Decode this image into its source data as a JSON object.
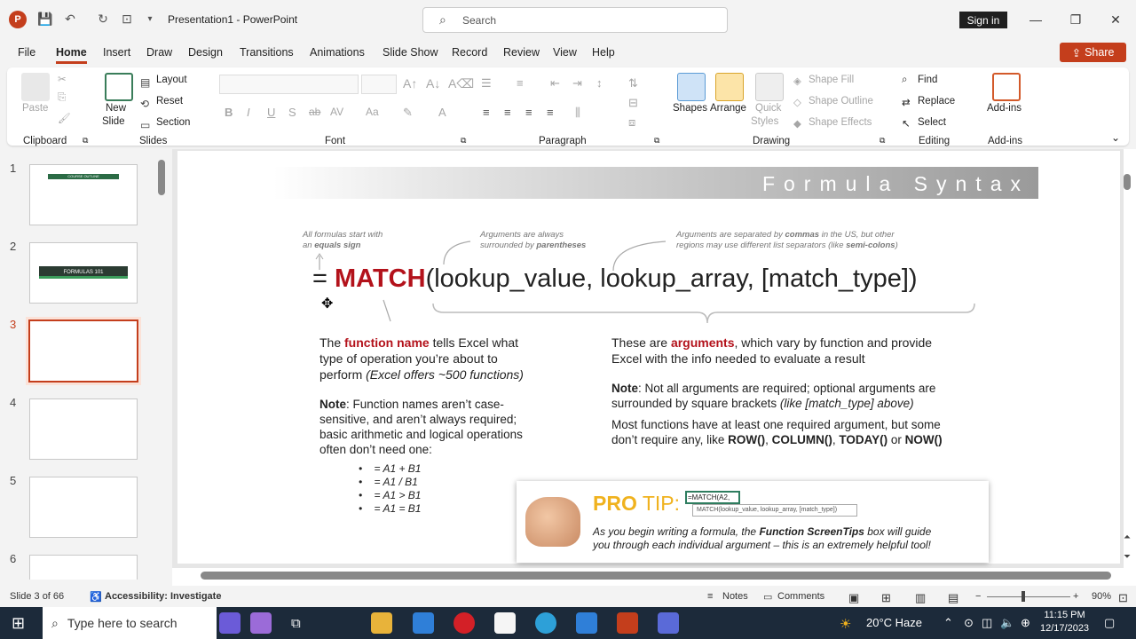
{
  "app": {
    "title": "Presentation1  -  PowerPoint",
    "search_placeholder": "Search",
    "signin": "Sign in",
    "share": "Share"
  },
  "menu": [
    "File",
    "Home",
    "Insert",
    "Draw",
    "Design",
    "Transitions",
    "Animations",
    "Slide Show",
    "Record",
    "Review",
    "View",
    "Help"
  ],
  "ribbon": {
    "clipboard": {
      "label": "Clipboard",
      "paste": "Paste"
    },
    "slides": {
      "label": "Slides",
      "new_slide": "New",
      "new_slide2": "Slide",
      "layout": "Layout",
      "reset": "Reset",
      "section": "Section"
    },
    "font": {
      "label": "Font"
    },
    "paragraph": {
      "label": "Paragraph"
    },
    "drawing": {
      "label": "Drawing",
      "shapes": "Shapes",
      "arrange": "Arrange",
      "quick_styles": "Quick",
      "quick_styles2": "Styles",
      "shape_fill": "Shape Fill",
      "shape_outline": "Shape Outline",
      "shape_effects": "Shape Effects"
    },
    "editing": {
      "label": "Editing",
      "find": "Find",
      "replace": "Replace",
      "select": "Select"
    },
    "addins": {
      "label": "Add-ins",
      "addins": "Add-ins"
    }
  },
  "slides_pane": {
    "numbers": [
      "1",
      "2",
      "3",
      "4",
      "5",
      "6"
    ],
    "thumb2_title": "FORMULAS 101",
    "thumb1_title": "COURSE OUTLINE"
  },
  "slide": {
    "banner": "Formula Syntax",
    "hint1a": "All formulas start with",
    "hint1b": "an ",
    "hint1c": "equals sign",
    "hint2a": "Arguments are always",
    "hint2b": "surrounded by ",
    "hint2c": "parentheses",
    "hint3a": "Arguments are separated by ",
    "hint3b": "commas",
    "hint3c": " in the US, but other",
    "hint3d": "regions may use different list separators (like ",
    "hint3e": "semi-colons",
    "hint3f": ")",
    "formula_eq": "= ",
    "formula_fn": "MATCH",
    "formula_args": "(lookup_value, lookup_array, [match_type])",
    "left1a": "The ",
    "left1b": "function name",
    "left1c": " tells Excel what",
    "left1d": "type of operation you’re about to",
    "left1e": "perform ",
    "left1f": "(Excel offers ~500 functions)",
    "note_label": "Note",
    "left2a": ": Function names aren’t case-",
    "left2b": "sensitive, and aren’t always required;",
    "left2c": "basic arithmetic and logical operations",
    "left2d": "often don’t need one:",
    "bullets": [
      "= A1 + B1",
      "= A1 / B1",
      "= A1 > B1",
      "= A1 = B1"
    ],
    "right1a": "These are ",
    "right1b": "arguments",
    "right1c": ", which vary by function and provide",
    "right1d": "Excel with the info needed to evaluate a result",
    "right2a": ": Not all arguments are required; optional arguments are",
    "right2b": "surrounded by square brackets ",
    "right2c": "(like [match_type] above)",
    "right3a": "Most functions have at least one required argument, but some",
    "right3b": "don’t require any, like ",
    "right3c": "ROW()",
    "right3d": ", ",
    "right3e": "COLUMN()",
    "right3f": ", ",
    "right3g": "TODAY()",
    "right3h": " or ",
    "right3i": "NOW()",
    "protip_a": "PRO",
    "protip_b": " TIP:",
    "protip_box": "=MATCH(A2,",
    "protip_tip": "MATCH(lookup_value, lookup_array, [match_type])",
    "protip_t1": "As you begin writing a formula, the ",
    "protip_t2": "Function ScreenTips",
    "protip_t3": " box will guide",
    "protip_t4": "you through each individual argument – this is an extremely helpful tool!"
  },
  "status": {
    "slide": "Slide 3 of 66",
    "accessibility": "Accessibility: Investigate",
    "notes": "Notes",
    "comments": "Comments",
    "zoom": "90%"
  },
  "taskbar": {
    "search": "Type here to search",
    "weather": "20°C  Haze",
    "time": "11:15 PM",
    "date": "12/17/2023"
  }
}
